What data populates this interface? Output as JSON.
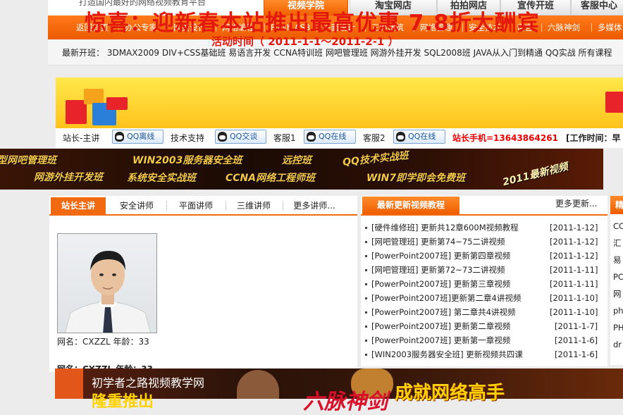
{
  "top": {
    "tagline": "打造国内最好的网络视频教育平台",
    "tabs": [
      "视频学院",
      "淘宝网店",
      "拍拍网店",
      "宣传开班",
      "客服中心"
    ]
  },
  "nav": [
    "返回首页",
    "办公专家",
    "网页设计",
    "网络编程",
    "Flash AS3",
    "平面设计",
    "三维建筑",
    "网络管理",
    "安全技术",
    "语言",
    "六脉神剑",
    "多媒体"
  ],
  "new_classes": "最新开班： 3DMAX2009 DIV+CSS基础班 易语言开发 CCNA特训班 网吧管理班 网游外挂开发 SQL2008班 JAVA从入门到精通 QQ实战 所有课程",
  "banner": {
    "title": "惊喜：迎新春本站推出最高优惠 7.8折大酬宾",
    "subtitle": "活动时间（ 2011-1-1～2011-2-1 ）"
  },
  "service": {
    "lecturer_label": "站长-主讲",
    "support_label": "技术支持",
    "cs1_label": "客服1",
    "cs2_label": "客服2",
    "qq_offline": "QQ离线",
    "qq_chat": "QQ交谈",
    "qq_online": "QQ在线",
    "phone": "站长手机=13643864261",
    "worktime": "[工作时间：早"
  },
  "class_banner": {
    "items": [
      "型网吧管理班",
      "WIN2003服务器安全班",
      "远控班",
      "QQ技术实战班",
      "网游外挂开发班",
      "系统安全实战班",
      "CCNA网络工程师班",
      "WIN7即学即会免费班",
      "2011最新视频"
    ]
  },
  "teachers": {
    "tabs": [
      "站长主讲",
      "安全讲师",
      "平面讲师",
      "三维讲师",
      "更多讲师..."
    ],
    "profile_line": "网名：CXZZL 年龄：33",
    "profile_line2": "网名：CXZZL 年龄：33"
  },
  "updates": {
    "title": "最新更新视频教程",
    "more": "更多更新...",
    "items": [
      {
        "text": "[硬件维修班] 更新共12章600M视频教程",
        "date": "[2011-1-12]"
      },
      {
        "text": "[网吧管理班] 更新第74~75二讲视频",
        "date": "[2011-1-12]"
      },
      {
        "text": "[PowerPoint2007班] 更新第四章视频",
        "date": "[2011-1-12]"
      },
      {
        "text": "[网吧管理班] 更新第72~73二讲视频",
        "date": "[2011-1-11]"
      },
      {
        "text": "[PowerPoint2007班] 更新第三章视频",
        "date": "[2011-1-11]"
      },
      {
        "text": "[PowerPoint2007班]更新第二章4讲视频",
        "date": "[2011-1-10]"
      },
      {
        "text": "[PowerPoint2007班] 第二章共4讲视频",
        "date": "[2011-1-10]"
      },
      {
        "text": "[PowerPoint2007班] 更新第二章视频",
        "date": "[2011-1-7]"
      },
      {
        "text": "[PowerPoint2007班] 更新第一章视频",
        "date": "[2011-1-6]"
      },
      {
        "text": "[WIN2003服务器安全班] 更新视频共四课",
        "date": "[2011-1-6]"
      }
    ]
  },
  "right_panel": {
    "head": "精",
    "items": [
      "CC",
      "汇",
      "易",
      "PC",
      "网",
      "ph",
      "PH",
      "dr"
    ]
  },
  "bottom_banner": {
    "site": "初学者之路视频教学网",
    "slogan": "成就网络高手",
    "left_text": "隆重推出",
    "mid_text": "六脉神剑"
  }
}
